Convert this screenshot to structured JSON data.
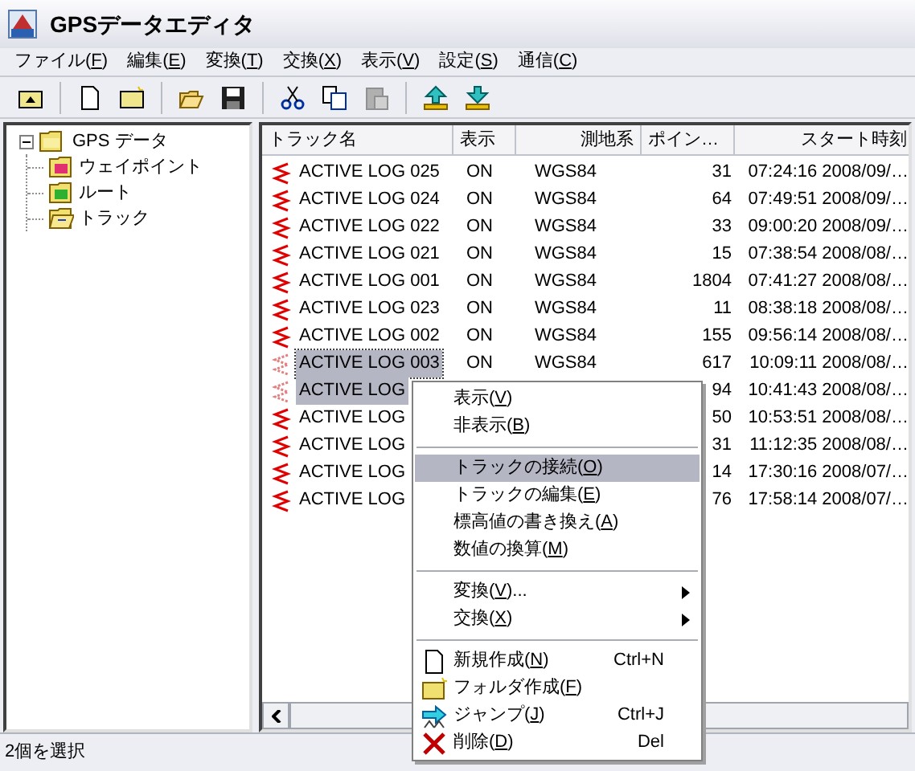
{
  "window": {
    "title": "GPSデータエディタ"
  },
  "menu_bar": [
    "ファイル(F)",
    "編集(E)",
    "変換(T)",
    "交換(X)",
    "表示(V)",
    "設定(S)",
    "通信(C)"
  ],
  "tree": {
    "label": "GPS データ",
    "expanded": true,
    "children": [
      {
        "label": "ウェイポイント",
        "kind": "waypoint"
      },
      {
        "label": "ルート",
        "kind": "route"
      },
      {
        "label": "トラック",
        "kind": "track"
      }
    ]
  },
  "table": {
    "columns": [
      "トラック名",
      "表示",
      "測地系",
      "ポイン…",
      "スタート時刻"
    ],
    "rows": [
      {
        "name": "ACTIVE LOG 025",
        "display": "ON",
        "datum": "WGS84",
        "points": "31",
        "start": "07:24:16 2008/09/…",
        "selected": false
      },
      {
        "name": "ACTIVE LOG 024",
        "display": "ON",
        "datum": "WGS84",
        "points": "64",
        "start": "07:49:51 2008/09/…",
        "selected": false
      },
      {
        "name": "ACTIVE LOG 022",
        "display": "ON",
        "datum": "WGS84",
        "points": "33",
        "start": "09:00:20 2008/09/…",
        "selected": false
      },
      {
        "name": "ACTIVE LOG 021",
        "display": "ON",
        "datum": "WGS84",
        "points": "15",
        "start": "07:38:54 2008/08/…",
        "selected": false
      },
      {
        "name": "ACTIVE LOG 001",
        "display": "ON",
        "datum": "WGS84",
        "points": "1804",
        "start": "07:41:27 2008/08/…",
        "selected": false
      },
      {
        "name": "ACTIVE LOG 023",
        "display": "ON",
        "datum": "WGS84",
        "points": "11",
        "start": "08:38:18 2008/08/…",
        "selected": false
      },
      {
        "name": "ACTIVE LOG 002",
        "display": "ON",
        "datum": "WGS84",
        "points": "155",
        "start": "09:56:14 2008/08/…",
        "selected": false
      },
      {
        "name": "ACTIVE LOG 003",
        "display": "ON",
        "datum": "WGS84",
        "points": "617",
        "start": "10:09:11 2008/08/…",
        "selected": true
      },
      {
        "name": "ACTIVE LOG",
        "points": "94",
        "start": "10:41:43 2008/08/…",
        "selected": true
      },
      {
        "name": "ACTIVE LOG",
        "points": "50",
        "start": "10:53:51 2008/08/…",
        "selected": false
      },
      {
        "name": "ACTIVE LOG",
        "points": "31",
        "start": "11:12:35 2008/08/…",
        "selected": false
      },
      {
        "name": "ACTIVE LOG",
        "points": "14",
        "start": "17:30:16 2008/07/…",
        "selected": false
      },
      {
        "name": "ACTIVE LOG",
        "points": "76",
        "start": "17:58:14 2008/07/…",
        "selected": false
      }
    ]
  },
  "context_menu": {
    "items": [
      {
        "kind": "item",
        "label": "表示(V)",
        "selected": false
      },
      {
        "kind": "item",
        "label": "非表示(B)",
        "selected": false
      },
      {
        "kind": "separator"
      },
      {
        "kind": "item",
        "label": "トラックの接続(O)",
        "selected": true
      },
      {
        "kind": "item",
        "label": "トラックの編集(E)",
        "selected": false
      },
      {
        "kind": "item",
        "label": "標高値の書き換え(A)",
        "selected": false
      },
      {
        "kind": "item",
        "label": "数値の換算(M)",
        "selected": false
      },
      {
        "kind": "separator"
      },
      {
        "kind": "submenu",
        "label": "変換(V)...",
        "selected": false
      },
      {
        "kind": "submenu",
        "label": "交換(X)",
        "selected": false
      },
      {
        "kind": "separator"
      },
      {
        "kind": "new",
        "label": "新規作成(N)",
        "shortcut": "Ctrl+N",
        "selected": false
      },
      {
        "kind": "new_folder",
        "label": "フォルダ作成(F)",
        "selected": false
      },
      {
        "kind": "jump",
        "label": "ジャンプ(J)",
        "shortcut": "Ctrl+J",
        "selected": false
      },
      {
        "kind": "delete",
        "label": "削除(D)",
        "shortcut": "Del",
        "selected": false
      }
    ]
  },
  "status_bar": "2個を選択"
}
